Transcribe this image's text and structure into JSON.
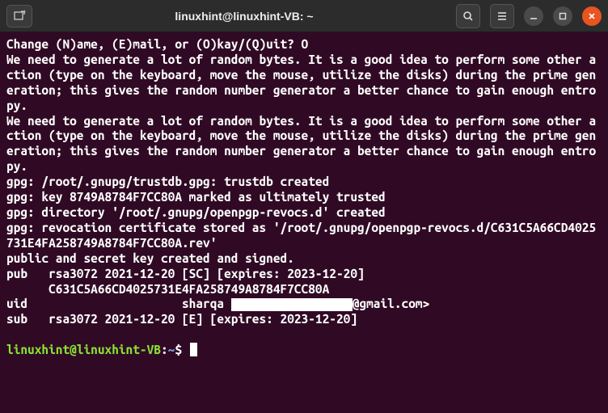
{
  "titlebar": {
    "title": "linuxhint@linuxhint-VB: ~"
  },
  "terminal": {
    "lines": [
      "Change (N)ame, (E)mail, or (O)kay/(Q)uit? O",
      "We need to generate a lot of random bytes. It is a good idea to perform some other action (type on the keyboard, move the mouse, utilize the disks) during the prime generation; this gives the random number generator a better chance to gain enough entropy.",
      "We need to generate a lot of random bytes. It is a good idea to perform some other action (type on the keyboard, move the mouse, utilize the disks) during the prime generation; this gives the random number generator a better chance to gain enough entropy.",
      "gpg: /root/.gnupg/trustdb.gpg: trustdb created",
      "gpg: key 8749A8784F7CC80A marked as ultimately trusted",
      "gpg: directory '/root/.gnupg/openpgp-revocs.d' created",
      "gpg: revocation certificate stored as '/root/.gnupg/openpgp-revocs.d/C631C5A66CD4025731E4FA258749A8784F7CC80A.rev'",
      "public and secret key created and signed.",
      "",
      "pub   rsa3072 2021-12-20 [SC] [expires: 2023-12-20]",
      "      C631C5A66CD4025731E4FA258749A8784F7CC80A"
    ],
    "uid_prefix": "uid                      sharqa ",
    "uid_suffix": "@gmail.com>",
    "sub_line": "sub   rsa3072 2021-12-20 [E] [expires: 2023-12-20]",
    "prompt": {
      "user": "linuxhint@linuxhint-VB",
      "colon": ":",
      "path": "~",
      "dollar": "$"
    }
  }
}
